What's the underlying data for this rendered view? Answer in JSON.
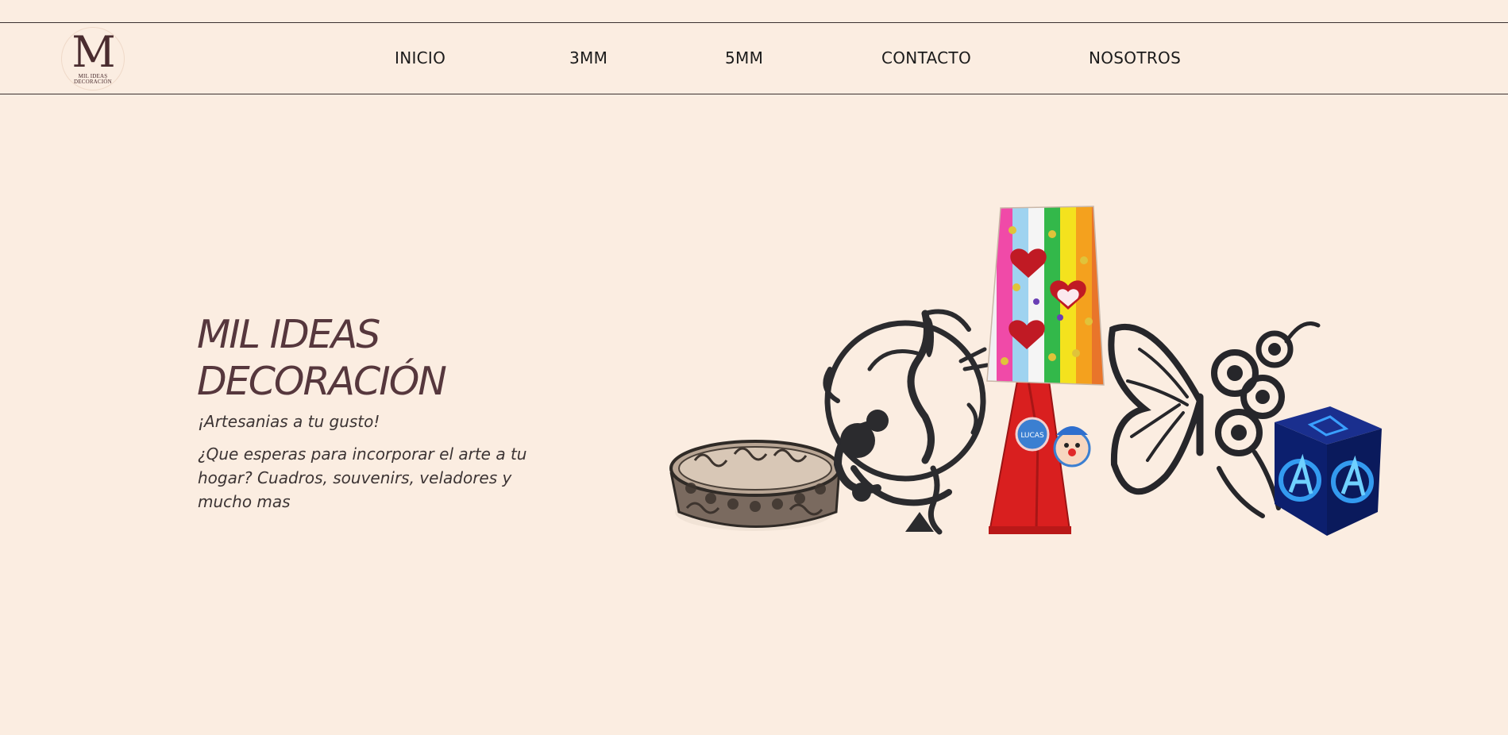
{
  "brand": {
    "logo_letter": "M",
    "logo_line1": "MIL IDEAS",
    "logo_line2": "DECORACIÓN"
  },
  "nav": {
    "items": [
      {
        "label": "INICIO"
      },
      {
        "label": "3MM"
      },
      {
        "label": "5MM"
      },
      {
        "label": "CONTACTO"
      },
      {
        "label": "NOSOTROS"
      }
    ]
  },
  "hero": {
    "title_line1": "MIL IDEAS",
    "title_line2": "DECORACIÓN",
    "tagline": "¡Artesanias a tu gusto!",
    "description": "¿Que esperas para incorporar el arte a tu hogar? Cuadros, souvenirs, veladores y mucho mas",
    "lamp_badge": "LUCAS"
  },
  "colors": {
    "background": "#fbede1",
    "title": "#56373d",
    "text": "#3c3434",
    "nav_text": "#1b1b1b",
    "border": "#3a3030"
  },
  "icons": {
    "product_image": "product-collage-image"
  }
}
